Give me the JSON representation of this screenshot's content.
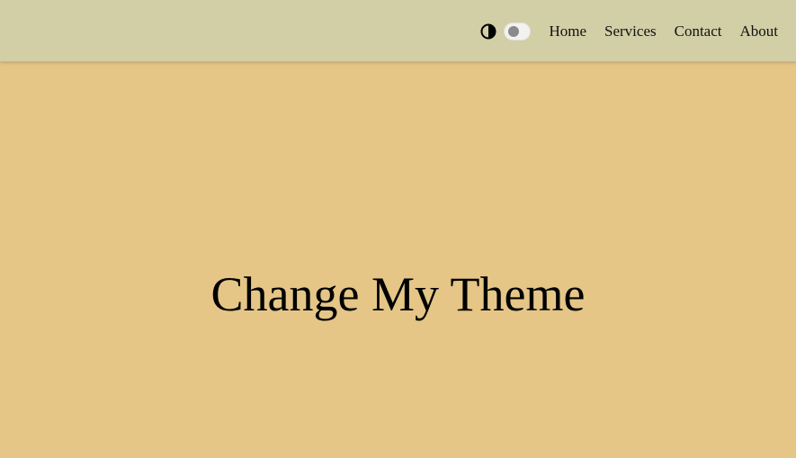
{
  "navbar": {
    "theme_icon": "half-circle-contrast-icon",
    "toggle_state": "off",
    "links": [
      {
        "label": "Home"
      },
      {
        "label": "Services"
      },
      {
        "label": "Contact"
      },
      {
        "label": "About"
      }
    ]
  },
  "hero": {
    "title": "Change My Theme"
  },
  "colors": {
    "page_background": "#e5c687",
    "navbar_background": "#d2cea6",
    "toggle_track": "#f2f2f0",
    "toggle_knob": "#8a8a8a",
    "text": "#111111"
  }
}
